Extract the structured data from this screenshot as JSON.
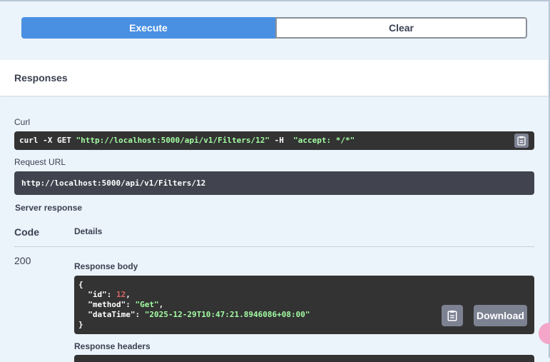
{
  "execute": {
    "execute_label": "Execute",
    "clear_label": "Clear"
  },
  "responses": {
    "title": "Responses",
    "curl_label": "Curl",
    "curl": {
      "prefix": "curl -X GET ",
      "url": "\"http://localhost:5000/api/v1/Filters/12\"",
      "flag": " -H  ",
      "header": "\"accept: */*\""
    },
    "request_url_label": "Request URL",
    "request_url": "http://localhost:5000/api/v1/Filters/12",
    "server_response_label": "Server response",
    "code_header": "Code",
    "details_header": "Details",
    "code": "200",
    "body_label": "Response body",
    "body": {
      "open": "{",
      "id_key": "  \"id\": ",
      "id_val": "12",
      "method_key": "  \"method\": ",
      "method_val": "\"Get\"",
      "datatime_key": "  \"dataTime\": ",
      "datatime_val": "\"2025-12-29T10:47:21.8946086+08:00\"",
      "close": "}"
    },
    "download_label": "Download",
    "headers_label": "Response headers"
  },
  "icons": {
    "copy": "clipboard-icon"
  }
}
